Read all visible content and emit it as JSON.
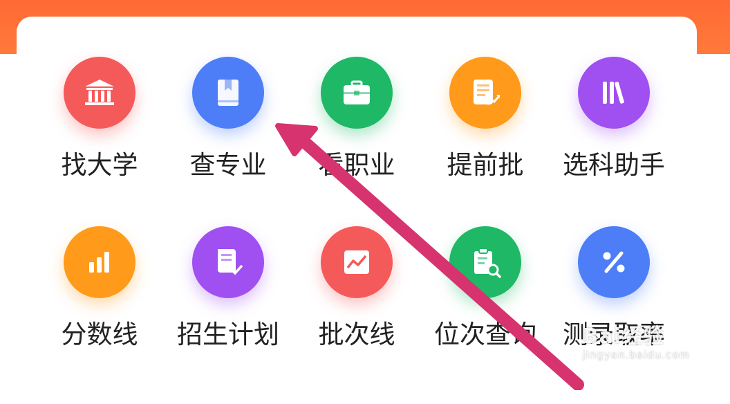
{
  "colors": {
    "banner": "#ff6a35",
    "arrow": "#d6336f",
    "label": "#222222"
  },
  "items": [
    {
      "label": "找大学",
      "icon": "university-icon",
      "color": "#f55a5a"
    },
    {
      "label": "查专业",
      "icon": "book-icon",
      "color": "#4d7ef7"
    },
    {
      "label": "看职业",
      "icon": "briefcase-icon",
      "color": "#1fb866"
    },
    {
      "label": "提前批",
      "icon": "document-trend-icon",
      "color": "#ff9a1a"
    },
    {
      "label": "选科助手",
      "icon": "books-icon",
      "color": "#a04ff0"
    },
    {
      "label": "分数线",
      "icon": "bar-chart-icon",
      "color": "#ff9a1a"
    },
    {
      "label": "招生计划",
      "icon": "document-check-icon",
      "color": "#a04ff0"
    },
    {
      "label": "批次线",
      "icon": "line-chart-icon",
      "color": "#f55a5a"
    },
    {
      "label": "位次查询",
      "icon": "clipboard-search-icon",
      "color": "#1fb866"
    },
    {
      "label": "测录取率",
      "icon": "percent-icon",
      "color": "#4d7ef7"
    }
  ],
  "watermark": {
    "logo": "Bai经验",
    "url": "jingyan.baidu.com"
  }
}
